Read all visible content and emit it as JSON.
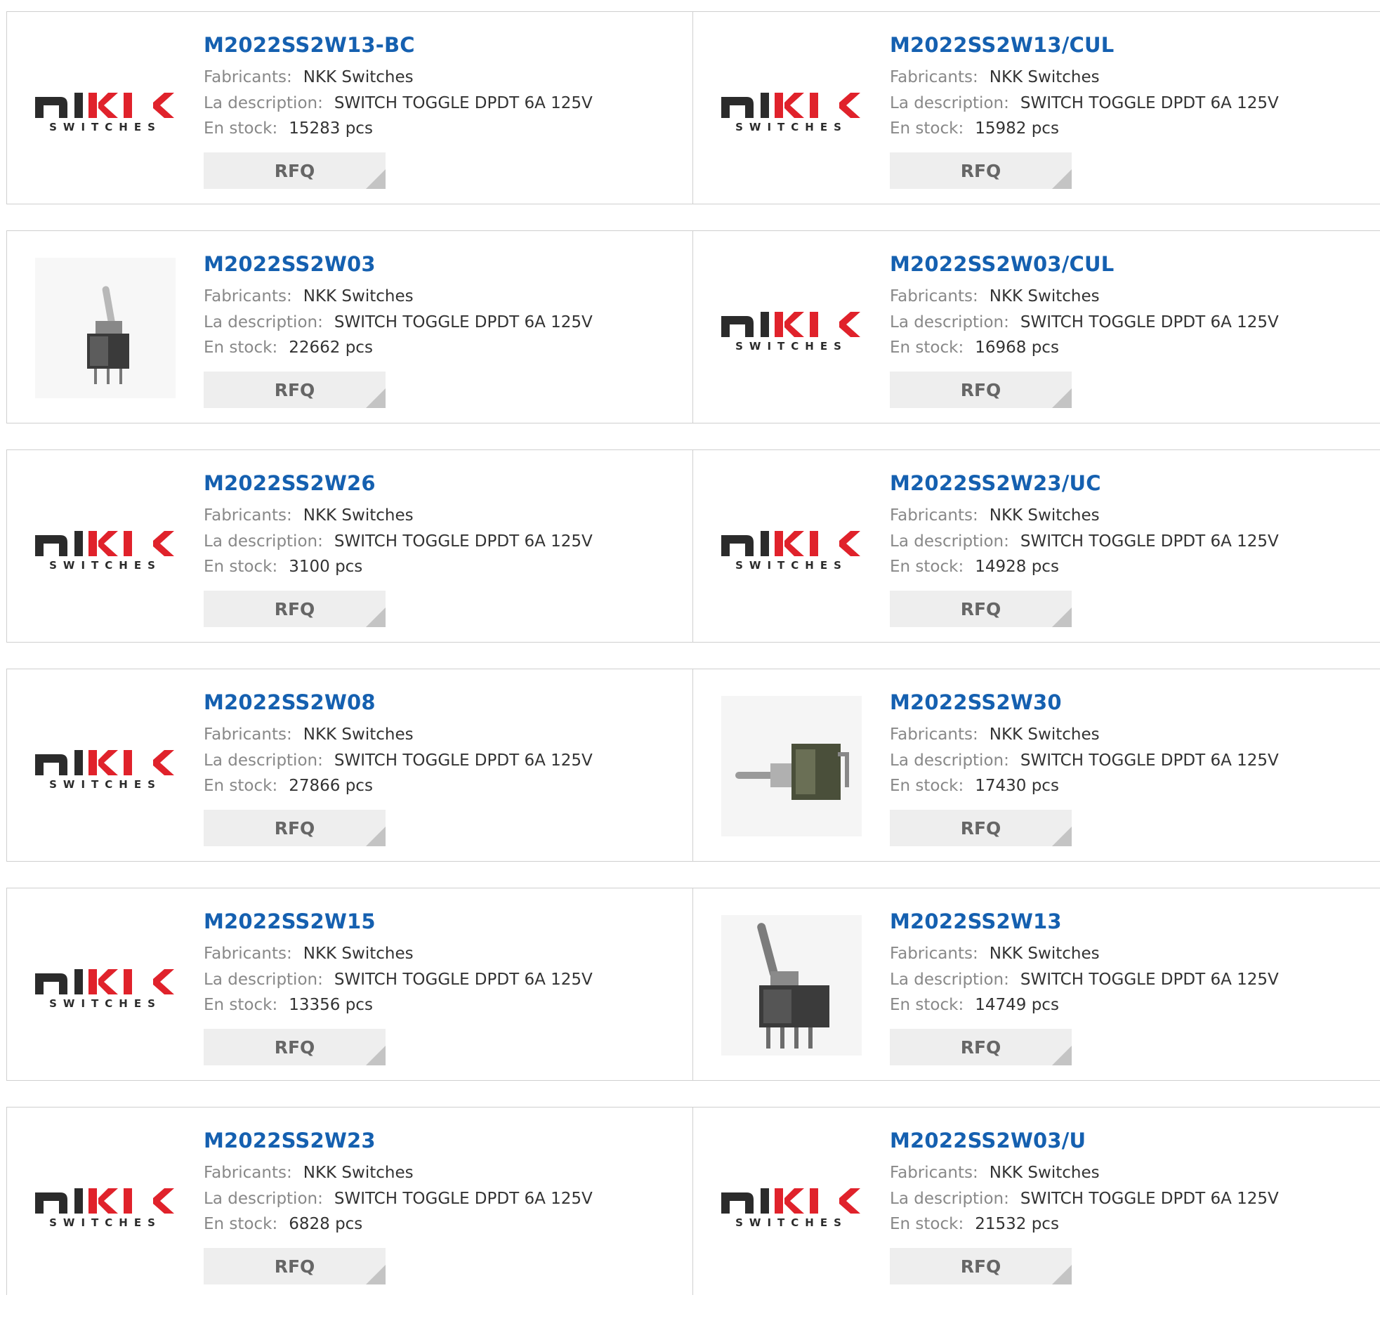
{
  "labels": {
    "manufacturer": "Fabricants:",
    "description": "La description:",
    "stock": "En stock:",
    "rfq": "RFQ"
  },
  "logo_text": {
    "main": "NKK",
    "sub": "SWITCHES"
  },
  "products": [
    {
      "part": "M2022SS2W13-BC",
      "manufacturer": "NKK Switches",
      "description": "SWITCH TOGGLE DPDT 6A 125V",
      "stock": "15283 pcs",
      "image": "nkk-logo"
    },
    {
      "part": "M2022SS2W13/CUL",
      "manufacturer": "NKK Switches",
      "description": "SWITCH TOGGLE DPDT 6A 125V",
      "stock": "15982 pcs",
      "image": "nkk-logo"
    },
    {
      "part": "M2022SS2W03",
      "manufacturer": "NKK Switches",
      "description": "SWITCH TOGGLE DPDT 6A 125V",
      "stock": "22662 pcs",
      "image": "toggle-switch-photo"
    },
    {
      "part": "M2022SS2W03/CUL",
      "manufacturer": "NKK Switches",
      "description": "SWITCH TOGGLE DPDT 6A 125V",
      "stock": "16968 pcs",
      "image": "nkk-logo"
    },
    {
      "part": "M2022SS2W26",
      "manufacturer": "NKK Switches",
      "description": "SWITCH TOGGLE DPDT 6A 125V",
      "stock": "3100 pcs",
      "image": "nkk-logo"
    },
    {
      "part": "M2022SS2W23/UC",
      "manufacturer": "NKK Switches",
      "description": "SWITCH TOGGLE DPDT 6A 125V",
      "stock": "14928 pcs",
      "image": "nkk-logo"
    },
    {
      "part": "M2022SS2W08",
      "manufacturer": "NKK Switches",
      "description": "SWITCH TOGGLE DPDT 6A 125V",
      "stock": "27866 pcs",
      "image": "nkk-logo"
    },
    {
      "part": "M2022SS2W30",
      "manufacturer": "NKK Switches",
      "description": "SWITCH TOGGLE DPDT 6A 125V",
      "stock": "17430 pcs",
      "image": "right-angle-toggle-photo"
    },
    {
      "part": "M2022SS2W15",
      "manufacturer": "NKK Switches",
      "description": "SWITCH TOGGLE DPDT 6A 125V",
      "stock": "13356 pcs",
      "image": "nkk-logo"
    },
    {
      "part": "M2022SS2W13",
      "manufacturer": "NKK Switches",
      "description": "SWITCH TOGGLE DPDT 6A 125V",
      "stock": "14749 pcs",
      "image": "tall-toggle-photo"
    },
    {
      "part": "M2022SS2W23",
      "manufacturer": "NKK Switches",
      "description": "SWITCH TOGGLE DPDT 6A 125V",
      "stock": "6828 pcs",
      "image": "nkk-logo"
    },
    {
      "part": "M2022SS2W03/U",
      "manufacturer": "NKK Switches",
      "description": "SWITCH TOGGLE DPDT 6A 125V",
      "stock": "21532 pcs",
      "image": "nkk-logo"
    }
  ],
  "colors": {
    "link": "#1560b0",
    "logo_red": "#e0222b",
    "logo_dark": "#2b2b2b"
  }
}
